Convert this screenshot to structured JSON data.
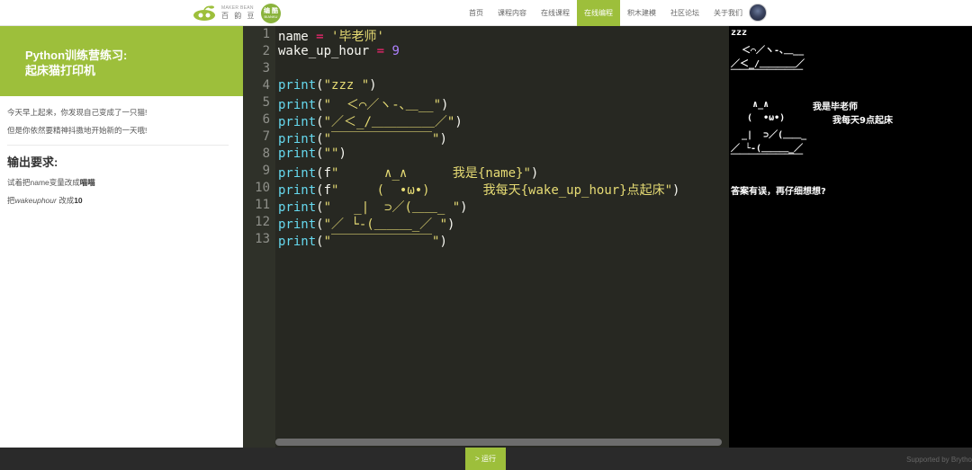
{
  "header": {
    "logo_en": "MAKER BEAN",
    "logo_cn": "百 韵 豆",
    "badge_main": "编 酷",
    "badge_sub": "BIANKU",
    "nav": [
      {
        "label": "首页"
      },
      {
        "label": "课程内容"
      },
      {
        "label": "在线课程"
      },
      {
        "label": "在线编程",
        "active": true
      },
      {
        "label": "积木建模"
      },
      {
        "label": "社区论坛"
      },
      {
        "label": "关于我们"
      }
    ],
    "accent_color": "#9dbf3b"
  },
  "left_panel": {
    "title_line1": "Python训练营练习:",
    "title_line2": "起床猫打印机",
    "intro_1": "今天早上起来，你发现自己变成了一只猫!",
    "intro_2": "但是你依然要精神抖擞地开始新的一天哦!",
    "req_title": "输出要求:",
    "req_1_prefix": "试着把name变量改成",
    "req_1_bold": "喵喵",
    "req_2_prefix": "把",
    "req_2_italic": "wakeuphour",
    "req_2_mid": " 改成",
    "req_2_bold": "10"
  },
  "editor": {
    "line_numbers": [
      "1",
      "2",
      "3",
      "4",
      "5",
      "6",
      "7",
      "8",
      "9",
      "10",
      "11",
      "12",
      "13"
    ],
    "lines": {
      "l1_var": "name",
      "l1_op": " = ",
      "l1_val": "'毕老师'",
      "l2_var": "wake_up_hour",
      "l2_op": " = ",
      "l2_val": "9",
      "print": "print",
      "l4_str": "\"zzz \"",
      "l5_str": "\"  ＜⌒／ヽ-､＿__\"",
      "l6_str": "\"／＜_/＿＿＿＿＿／\"",
      "l7_str": "\"￣￣￣￣￣￣￣￣\"",
      "l8_str": "\"\"",
      "l9_f": "f",
      "l9_str": "\"      ∧_∧      我是{name}\"",
      "l10_f": "f",
      "l10_str": "\"     (  •ω•)       我每天{wake_up_hour}点起床\"",
      "l11_str": "\"   _|  ⊃／(＿＿_ \"",
      "l12_str": "\"／ └-(＿＿＿_／ \"",
      "l13_str": "\"￣￣￣￣￣￣￣￣\""
    }
  },
  "output": {
    "o1": "zzz",
    "o2": "  ＜⌒／ヽ-､＿__",
    "o3": "／＜_/＿＿＿＿／",
    "o4": "￣￣￣￣￣￣￣￣",
    "o5": "    ∧_∧",
    "o5_text": "我是毕老师",
    "o6": "   (  •ω•)",
    "o6_text": "我每天9点起床",
    "o7": "  _|  ⊃／(＿＿_",
    "o8": "／ └-(＿＿＿_／",
    "o9": "￣￣￣￣￣￣￣￣",
    "o10": "答案有误，再仔细想想?"
  },
  "footer": {
    "run_label": "> 运行",
    "supported_by": "Supported by Brytho"
  }
}
